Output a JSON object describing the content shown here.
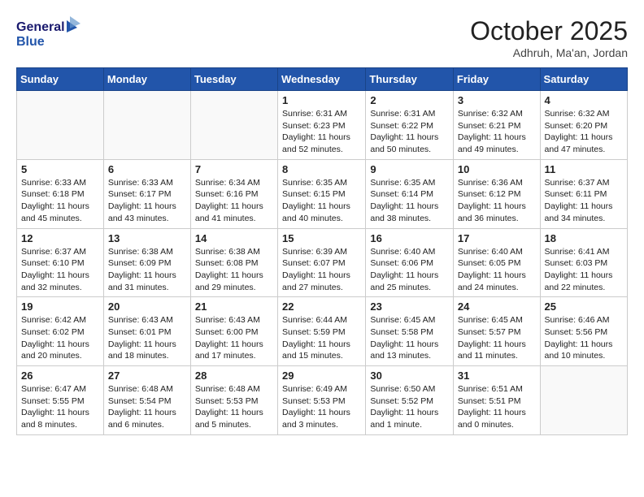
{
  "header": {
    "logo_line1": "General",
    "logo_line2": "Blue",
    "month": "October 2025",
    "location": "Adhruh, Ma'an, Jordan"
  },
  "weekdays": [
    "Sunday",
    "Monday",
    "Tuesday",
    "Wednesday",
    "Thursday",
    "Friday",
    "Saturday"
  ],
  "weeks": [
    [
      {
        "day": "",
        "info": ""
      },
      {
        "day": "",
        "info": ""
      },
      {
        "day": "",
        "info": ""
      },
      {
        "day": "1",
        "info": "Sunrise: 6:31 AM\nSunset: 6:23 PM\nDaylight: 11 hours\nand 52 minutes."
      },
      {
        "day": "2",
        "info": "Sunrise: 6:31 AM\nSunset: 6:22 PM\nDaylight: 11 hours\nand 50 minutes."
      },
      {
        "day": "3",
        "info": "Sunrise: 6:32 AM\nSunset: 6:21 PM\nDaylight: 11 hours\nand 49 minutes."
      },
      {
        "day": "4",
        "info": "Sunrise: 6:32 AM\nSunset: 6:20 PM\nDaylight: 11 hours\nand 47 minutes."
      }
    ],
    [
      {
        "day": "5",
        "info": "Sunrise: 6:33 AM\nSunset: 6:18 PM\nDaylight: 11 hours\nand 45 minutes."
      },
      {
        "day": "6",
        "info": "Sunrise: 6:33 AM\nSunset: 6:17 PM\nDaylight: 11 hours\nand 43 minutes."
      },
      {
        "day": "7",
        "info": "Sunrise: 6:34 AM\nSunset: 6:16 PM\nDaylight: 11 hours\nand 41 minutes."
      },
      {
        "day": "8",
        "info": "Sunrise: 6:35 AM\nSunset: 6:15 PM\nDaylight: 11 hours\nand 40 minutes."
      },
      {
        "day": "9",
        "info": "Sunrise: 6:35 AM\nSunset: 6:14 PM\nDaylight: 11 hours\nand 38 minutes."
      },
      {
        "day": "10",
        "info": "Sunrise: 6:36 AM\nSunset: 6:12 PM\nDaylight: 11 hours\nand 36 minutes."
      },
      {
        "day": "11",
        "info": "Sunrise: 6:37 AM\nSunset: 6:11 PM\nDaylight: 11 hours\nand 34 minutes."
      }
    ],
    [
      {
        "day": "12",
        "info": "Sunrise: 6:37 AM\nSunset: 6:10 PM\nDaylight: 11 hours\nand 32 minutes."
      },
      {
        "day": "13",
        "info": "Sunrise: 6:38 AM\nSunset: 6:09 PM\nDaylight: 11 hours\nand 31 minutes."
      },
      {
        "day": "14",
        "info": "Sunrise: 6:38 AM\nSunset: 6:08 PM\nDaylight: 11 hours\nand 29 minutes."
      },
      {
        "day": "15",
        "info": "Sunrise: 6:39 AM\nSunset: 6:07 PM\nDaylight: 11 hours\nand 27 minutes."
      },
      {
        "day": "16",
        "info": "Sunrise: 6:40 AM\nSunset: 6:06 PM\nDaylight: 11 hours\nand 25 minutes."
      },
      {
        "day": "17",
        "info": "Sunrise: 6:40 AM\nSunset: 6:05 PM\nDaylight: 11 hours\nand 24 minutes."
      },
      {
        "day": "18",
        "info": "Sunrise: 6:41 AM\nSunset: 6:03 PM\nDaylight: 11 hours\nand 22 minutes."
      }
    ],
    [
      {
        "day": "19",
        "info": "Sunrise: 6:42 AM\nSunset: 6:02 PM\nDaylight: 11 hours\nand 20 minutes."
      },
      {
        "day": "20",
        "info": "Sunrise: 6:43 AM\nSunset: 6:01 PM\nDaylight: 11 hours\nand 18 minutes."
      },
      {
        "day": "21",
        "info": "Sunrise: 6:43 AM\nSunset: 6:00 PM\nDaylight: 11 hours\nand 17 minutes."
      },
      {
        "day": "22",
        "info": "Sunrise: 6:44 AM\nSunset: 5:59 PM\nDaylight: 11 hours\nand 15 minutes."
      },
      {
        "day": "23",
        "info": "Sunrise: 6:45 AM\nSunset: 5:58 PM\nDaylight: 11 hours\nand 13 minutes."
      },
      {
        "day": "24",
        "info": "Sunrise: 6:45 AM\nSunset: 5:57 PM\nDaylight: 11 hours\nand 11 minutes."
      },
      {
        "day": "25",
        "info": "Sunrise: 6:46 AM\nSunset: 5:56 PM\nDaylight: 11 hours\nand 10 minutes."
      }
    ],
    [
      {
        "day": "26",
        "info": "Sunrise: 6:47 AM\nSunset: 5:55 PM\nDaylight: 11 hours\nand 8 minutes."
      },
      {
        "day": "27",
        "info": "Sunrise: 6:48 AM\nSunset: 5:54 PM\nDaylight: 11 hours\nand 6 minutes."
      },
      {
        "day": "28",
        "info": "Sunrise: 6:48 AM\nSunset: 5:53 PM\nDaylight: 11 hours\nand 5 minutes."
      },
      {
        "day": "29",
        "info": "Sunrise: 6:49 AM\nSunset: 5:53 PM\nDaylight: 11 hours\nand 3 minutes."
      },
      {
        "day": "30",
        "info": "Sunrise: 6:50 AM\nSunset: 5:52 PM\nDaylight: 11 hours\nand 1 minute."
      },
      {
        "day": "31",
        "info": "Sunrise: 6:51 AM\nSunset: 5:51 PM\nDaylight: 11 hours\nand 0 minutes."
      },
      {
        "day": "",
        "info": ""
      }
    ]
  ]
}
